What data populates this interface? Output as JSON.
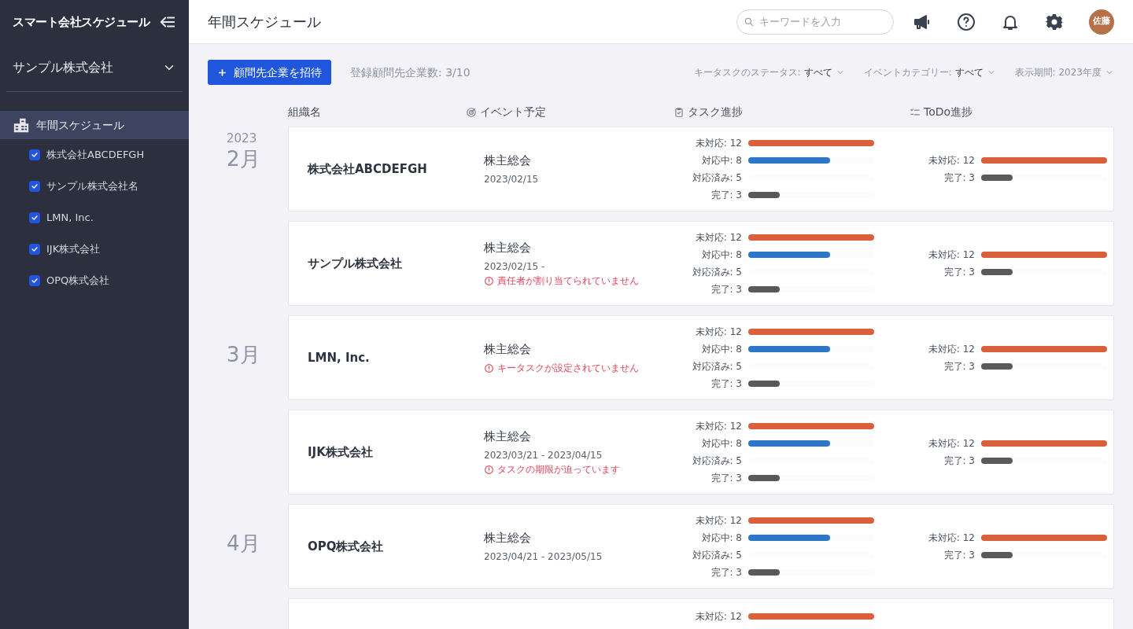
{
  "sidebar": {
    "app_title": "スマート会社スケジュール",
    "org_selector": "サンプル株式会社",
    "nav": [
      {
        "label": "年間スケジュール",
        "selected": true
      }
    ],
    "companies": [
      {
        "label": "株式会社ABCDEFGH",
        "checked": true
      },
      {
        "label": "サンプル株式会社名",
        "checked": true
      },
      {
        "label": "LMN, Inc.",
        "checked": true
      },
      {
        "label": "IJK株式会社",
        "checked": true
      },
      {
        "label": "OPQ株式会社",
        "checked": true
      }
    ]
  },
  "header": {
    "title": "年間スケジュール",
    "search": {
      "placeholder": "キーワードを入力"
    },
    "avatar": "佐藤"
  },
  "toolbar": {
    "invite_button": "顧問先企業を招待",
    "count": "登録顧問先企業数: 3/10",
    "filters": [
      {
        "label": "キータスクのステータス:",
        "value": "すべて"
      },
      {
        "label": "イベントカテゴリー:",
        "value": "すべて"
      },
      {
        "label": "表示期間: 2023年度"
      }
    ]
  },
  "columns": [
    {
      "label": "組織名"
    },
    {
      "label": "イベント予定",
      "kind": "target"
    },
    {
      "label": "タスク進捗",
      "kind": "clipboard"
    },
    {
      "label": "ToDo進捗",
      "kind": "checklist"
    }
  ],
  "rows": [
    {
      "year": "2023",
      "month": "2月",
      "name": "株式会社ABCDEFGH",
      "event": {
        "title": "株主総会",
        "date": "2023/02/15"
      },
      "tasks": [
        {
          "label": "未対応: 12",
          "level": 1,
          "kind": "open"
        },
        {
          "label": "対応中: 8",
          "level": 0.65,
          "kind": "in_progress"
        },
        {
          "label": "対応済み: 5",
          "kind": "resolved"
        },
        {
          "label": "完了: 3",
          "level": 0.25,
          "kind": "done"
        }
      ],
      "todos": [
        {
          "label": "未対応: 12",
          "level": 1,
          "kind": "open"
        },
        {
          "label": "完了: 3",
          "level": 0.25,
          "kind": "done"
        }
      ]
    },
    {
      "name": "サンプル株式会社",
      "event": {
        "title": "株主総会",
        "date": "2023/02/15 -",
        "warning": "責任者が割り当てられていません"
      },
      "tasks": [
        {
          "label": "未対応: 12",
          "level": 1,
          "kind": "open"
        },
        {
          "label": "対応中: 8",
          "level": 0.65,
          "kind": "in_progress"
        },
        {
          "label": "対応済み: 5",
          "kind": "resolved"
        },
        {
          "label": "完了: 3",
          "level": 0.25,
          "kind": "done"
        }
      ],
      "todos": [
        {
          "label": "未対応: 12",
          "level": 1,
          "kind": "open"
        },
        {
          "label": "完了: 3",
          "level": 0.25,
          "kind": "done"
        }
      ]
    },
    {
      "month": "3月",
      "name": "LMN, Inc.",
      "event": {
        "title": "株主総会",
        "warning": "キータスクが設定されていません"
      },
      "tasks": [
        {
          "label": "未対応: 12",
          "level": 1,
          "kind": "open"
        },
        {
          "label": "対応中: 8",
          "level": 0.65,
          "kind": "in_progress"
        },
        {
          "label": "対応済み: 5",
          "kind": "resolved"
        },
        {
          "label": "完了: 3",
          "level": 0.25,
          "kind": "done"
        }
      ],
      "todos": [
        {
          "label": "未対応: 12",
          "level": 1,
          "kind": "open"
        },
        {
          "label": "完了: 3",
          "level": 0.25,
          "kind": "done"
        }
      ]
    },
    {
      "name": "IJK株式会社",
      "event": {
        "title": "株主総会",
        "date": "2023/03/21 - 2023/04/15",
        "warning": "タスクの期限が迫っています"
      },
      "tasks": [
        {
          "label": "未対応: 12",
          "level": 1,
          "kind": "open"
        },
        {
          "label": "対応中: 8",
          "level": 0.65,
          "kind": "in_progress"
        },
        {
          "label": "対応済み: 5",
          "kind": "resolved"
        },
        {
          "label": "完了: 3",
          "level": 0.25,
          "kind": "done"
        }
      ],
      "todos": [
        {
          "label": "未対応: 12",
          "level": 1,
          "kind": "open"
        },
        {
          "label": "完了: 3",
          "level": 0.25,
          "kind": "done"
        }
      ]
    },
    {
      "month": "4月",
      "name": "OPQ株式会社",
      "event": {
        "title": "株主総会",
        "date": "2023/04/21 - 2023/05/15"
      },
      "tasks": [
        {
          "label": "未対応: 12",
          "level": 1,
          "kind": "open"
        },
        {
          "label": "対応中: 8",
          "level": 0.65,
          "kind": "in_progress"
        },
        {
          "label": "対応済み: 5",
          "kind": "resolved"
        },
        {
          "label": "完了: 3",
          "level": 0.25,
          "kind": "done"
        }
      ],
      "todos": [
        {
          "label": "未対応: 12",
          "level": 1,
          "kind": "open"
        },
        {
          "label": "完了: 3",
          "level": 0.25,
          "kind": "done"
        }
      ]
    },
    {
      "tasks": [
        {
          "label": "未対応: 12",
          "level": 1,
          "kind": "open"
        }
      ]
    }
  ]
}
